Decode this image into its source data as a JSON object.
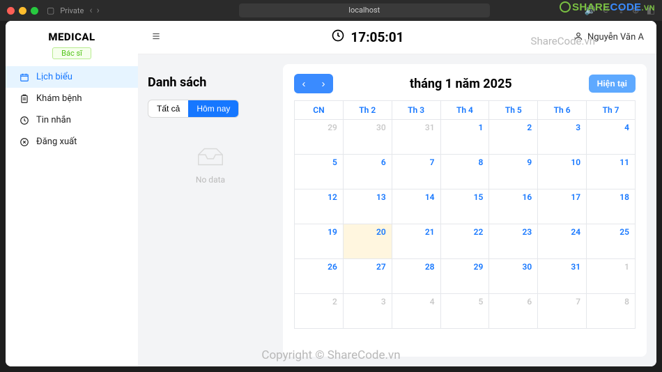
{
  "browser": {
    "private_label": "Private",
    "address": "localhost"
  },
  "brand": "MEDICAL",
  "role_badge": "Bác sĩ",
  "nav": {
    "schedule": "Lịch biểu",
    "exam": "Khám bệnh",
    "messages": "Tin nhắn",
    "logout": "Đăng xuất"
  },
  "clock": "17:05:01",
  "user_name": "Nguyễn Văn A",
  "list": {
    "title": "Danh sách",
    "all": "Tất cả",
    "today": "Hôm nay",
    "empty": "No data"
  },
  "calendar": {
    "month_title": "tháng 1 năm 2025",
    "today_btn": "Hiện tại",
    "dow": [
      "CN",
      "Th 2",
      "Th 3",
      "Th 4",
      "Th 5",
      "Th 6",
      "Th 7"
    ],
    "weeks": [
      [
        {
          "d": 29,
          "other": true
        },
        {
          "d": 30,
          "other": true
        },
        {
          "d": 31,
          "other": true
        },
        {
          "d": 1
        },
        {
          "d": 2
        },
        {
          "d": 3
        },
        {
          "d": 4
        }
      ],
      [
        {
          "d": 5
        },
        {
          "d": 6
        },
        {
          "d": 7
        },
        {
          "d": 8
        },
        {
          "d": 9
        },
        {
          "d": 10
        },
        {
          "d": 11
        }
      ],
      [
        {
          "d": 12
        },
        {
          "d": 13
        },
        {
          "d": 14
        },
        {
          "d": 15
        },
        {
          "d": 16
        },
        {
          "d": 17
        },
        {
          "d": 18
        }
      ],
      [
        {
          "d": 19
        },
        {
          "d": 20,
          "today": true
        },
        {
          "d": 21
        },
        {
          "d": 22
        },
        {
          "d": 23
        },
        {
          "d": 24
        },
        {
          "d": 25
        }
      ],
      [
        {
          "d": 26
        },
        {
          "d": 27
        },
        {
          "d": 28
        },
        {
          "d": 29
        },
        {
          "d": 30
        },
        {
          "d": 31
        },
        {
          "d": 1,
          "other": true
        }
      ],
      [
        {
          "d": 2,
          "other": true
        },
        {
          "d": 3,
          "other": true
        },
        {
          "d": 4,
          "other": true
        },
        {
          "d": 5,
          "other": true
        },
        {
          "d": 6,
          "other": true
        },
        {
          "d": 7,
          "other": true
        },
        {
          "d": 8,
          "other": true
        }
      ]
    ]
  },
  "watermarks": {
    "center": "Copyright © ShareCode.vn",
    "top_right": "ShareCode.vn",
    "logo1": "SHARE",
    "logo2": "CODE",
    "logo3": ".VN"
  }
}
